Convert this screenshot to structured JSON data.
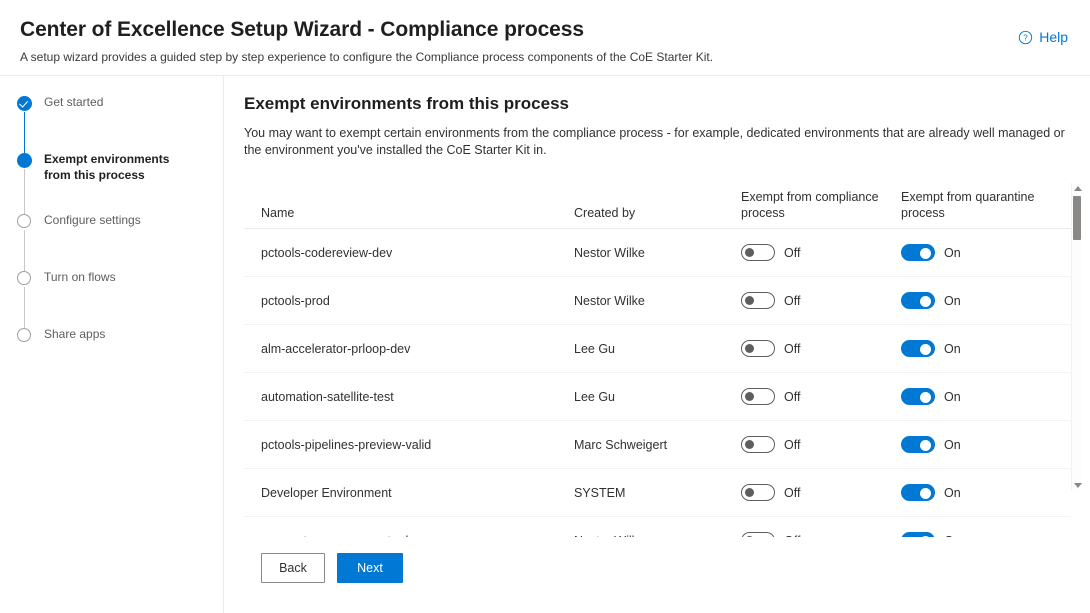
{
  "header": {
    "title": "Center of Excellence Setup Wizard - Compliance process",
    "subtitle": "A setup wizard provides a guided step by step experience to configure the Compliance process components of the CoE Starter Kit.",
    "help_label": "Help",
    "help_icon": "question-circle-icon"
  },
  "colors": {
    "accent": "#0078d4",
    "text": "#323130",
    "title": "#201f1e",
    "muted": "#605e5c",
    "divider": "#edebe9",
    "row_divider": "#f3f2f1",
    "scrollbar": "#8a8886"
  },
  "stepper": {
    "steps": [
      {
        "label": "Get started",
        "state": "completed"
      },
      {
        "label": "Exempt environments from this process",
        "state": "current"
      },
      {
        "label": "Configure settings",
        "state": "pending"
      },
      {
        "label": "Turn on flows",
        "state": "pending"
      },
      {
        "label": "Share apps",
        "state": "pending"
      }
    ]
  },
  "main": {
    "title": "Exempt environments from this process",
    "description": "You may want to exempt certain environments from the compliance process - for example, dedicated environments that are already well managed or the environment you've installed the CoE Starter Kit in.",
    "table": {
      "columns": {
        "name": "Name",
        "created_by": "Created by",
        "exempt_compliance": "Exempt from compliance process",
        "exempt_quarantine": "Exempt from quarantine process"
      },
      "rows": [
        {
          "name": "pctools-codereview-dev",
          "created_by": "Nestor Wilke",
          "exempt_compliance": "Off",
          "exempt_compliance_on": false,
          "exempt_quarantine": "On",
          "exempt_quarantine_on": true
        },
        {
          "name": "pctools-prod",
          "created_by": "Nestor Wilke",
          "exempt_compliance": "Off",
          "exempt_compliance_on": false,
          "exempt_quarantine": "On",
          "exempt_quarantine_on": true
        },
        {
          "name": "alm-accelerator-prloop-dev",
          "created_by": "Lee Gu",
          "exempt_compliance": "Off",
          "exempt_compliance_on": false,
          "exempt_quarantine": "On",
          "exempt_quarantine_on": true
        },
        {
          "name": "automation-satellite-test",
          "created_by": "Lee Gu",
          "exempt_compliance": "Off",
          "exempt_compliance_on": false,
          "exempt_quarantine": "On",
          "exempt_quarantine_on": true
        },
        {
          "name": "pctools-pipelines-preview-valid",
          "created_by": "Marc Schweigert",
          "exempt_compliance": "Off",
          "exempt_compliance_on": false,
          "exempt_quarantine": "On",
          "exempt_quarantine_on": true
        },
        {
          "name": "Developer Environment",
          "created_by": "SYSTEM",
          "exempt_compliance": "Off",
          "exempt_compliance_on": false,
          "exempt_quarantine": "On",
          "exempt_quarantine_on": true
        },
        {
          "name": "coe-nurture-components-dev",
          "created_by": "Nestor Wilke",
          "exempt_compliance": "Off",
          "exempt_compliance_on": false,
          "exempt_quarantine": "On",
          "exempt_quarantine_on": true
        }
      ]
    },
    "footer": {
      "back_label": "Back",
      "next_label": "Next"
    }
  }
}
